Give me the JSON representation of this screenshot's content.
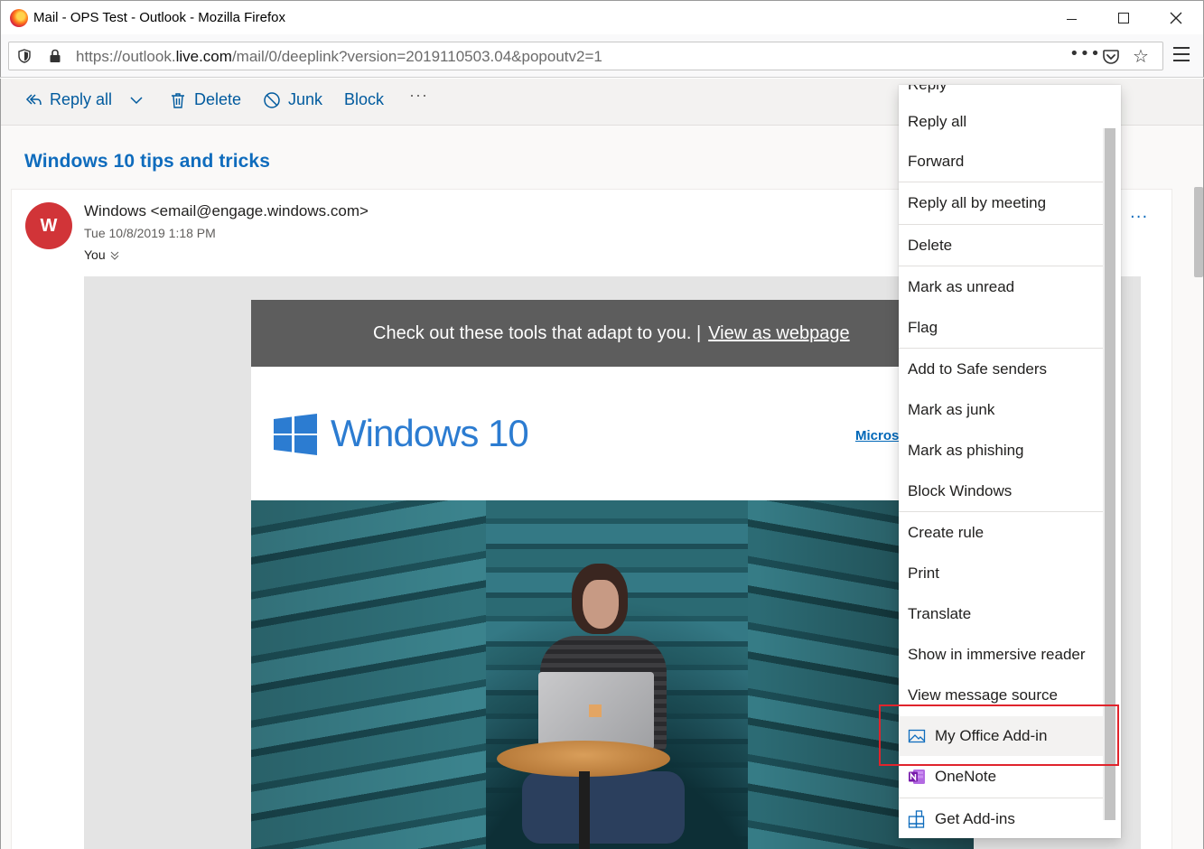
{
  "window": {
    "title": "Mail - OPS Test - Outlook - Mozilla Firefox"
  },
  "browser": {
    "url_prefix": "https://outlook.",
    "url_domain": "live.com",
    "url_path": "/mail/0/deeplink?version=2019110503.04&popoutv2=1",
    "page_actions": "•••"
  },
  "toolbar": {
    "reply_all": "Reply all",
    "delete": "Delete",
    "junk": "Junk",
    "block": "Block",
    "more": "···"
  },
  "message": {
    "subject": "Windows 10 tips and tricks",
    "avatar_initial": "W",
    "sender": "Windows <email@engage.windows.com>",
    "date": "Tue 10/8/2019 1:18 PM",
    "to": "You",
    "more": "···"
  },
  "email_content": {
    "banner_text": "Check out these tools that adapt to you. |",
    "banner_link": "View as webpage",
    "logo_text": "Windows 10",
    "micros_link": "Micros",
    "accent_color": "#2c7cd1"
  },
  "context_menu": {
    "partial_top": "Reply",
    "items": [
      "Reply all",
      "Forward",
      "Reply all by meeting",
      "Delete",
      "Mark as unread",
      "Flag",
      "Add to Safe senders",
      "Mark as junk",
      "Mark as phishing",
      "Block Windows",
      "Create rule",
      "Print",
      "Translate",
      "Show in immersive reader",
      "View message source"
    ],
    "addins": {
      "my_office_addin": "My Office Add-in",
      "onenote": "OneNote",
      "get_addins": "Get Add-ins"
    },
    "highlight_color": "#e0242c"
  }
}
